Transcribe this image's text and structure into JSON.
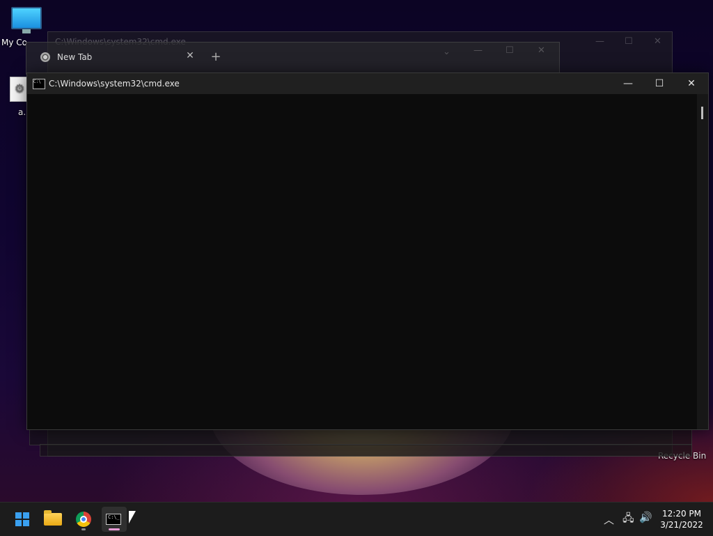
{
  "desktop": {
    "icons": [
      {
        "label": "My Co"
      },
      {
        "label": "a."
      }
    ],
    "recycle_bin": "Recycle Bin"
  },
  "background_windows": {
    "back_cmd_title": "C:\\Windows\\system32\\cmd.exe",
    "chrome_tab_label": "New Tab",
    "chrome_tab_close": "✕",
    "chrome_new_tab": "+"
  },
  "cmd_window": {
    "title": "C:\\Windows\\system32\\cmd.exe",
    "icon_text": "C:\\",
    "minimize": "—",
    "maximize": "☐",
    "close": "✕"
  },
  "taskbar": {
    "apps": [
      "start",
      "file-explorer",
      "chrome",
      "command-prompt"
    ],
    "cmd_icon_text": "C:\\_",
    "tray": {
      "chevron": "︿",
      "network": "🖧",
      "volume": "🔊"
    },
    "clock": {
      "time": "12:20 PM",
      "date": "3/21/2022"
    }
  },
  "colors": {
    "accent": "#3aa0f0",
    "active_indicator": "#e79bd6",
    "console_bg": "#0c0c0c"
  }
}
